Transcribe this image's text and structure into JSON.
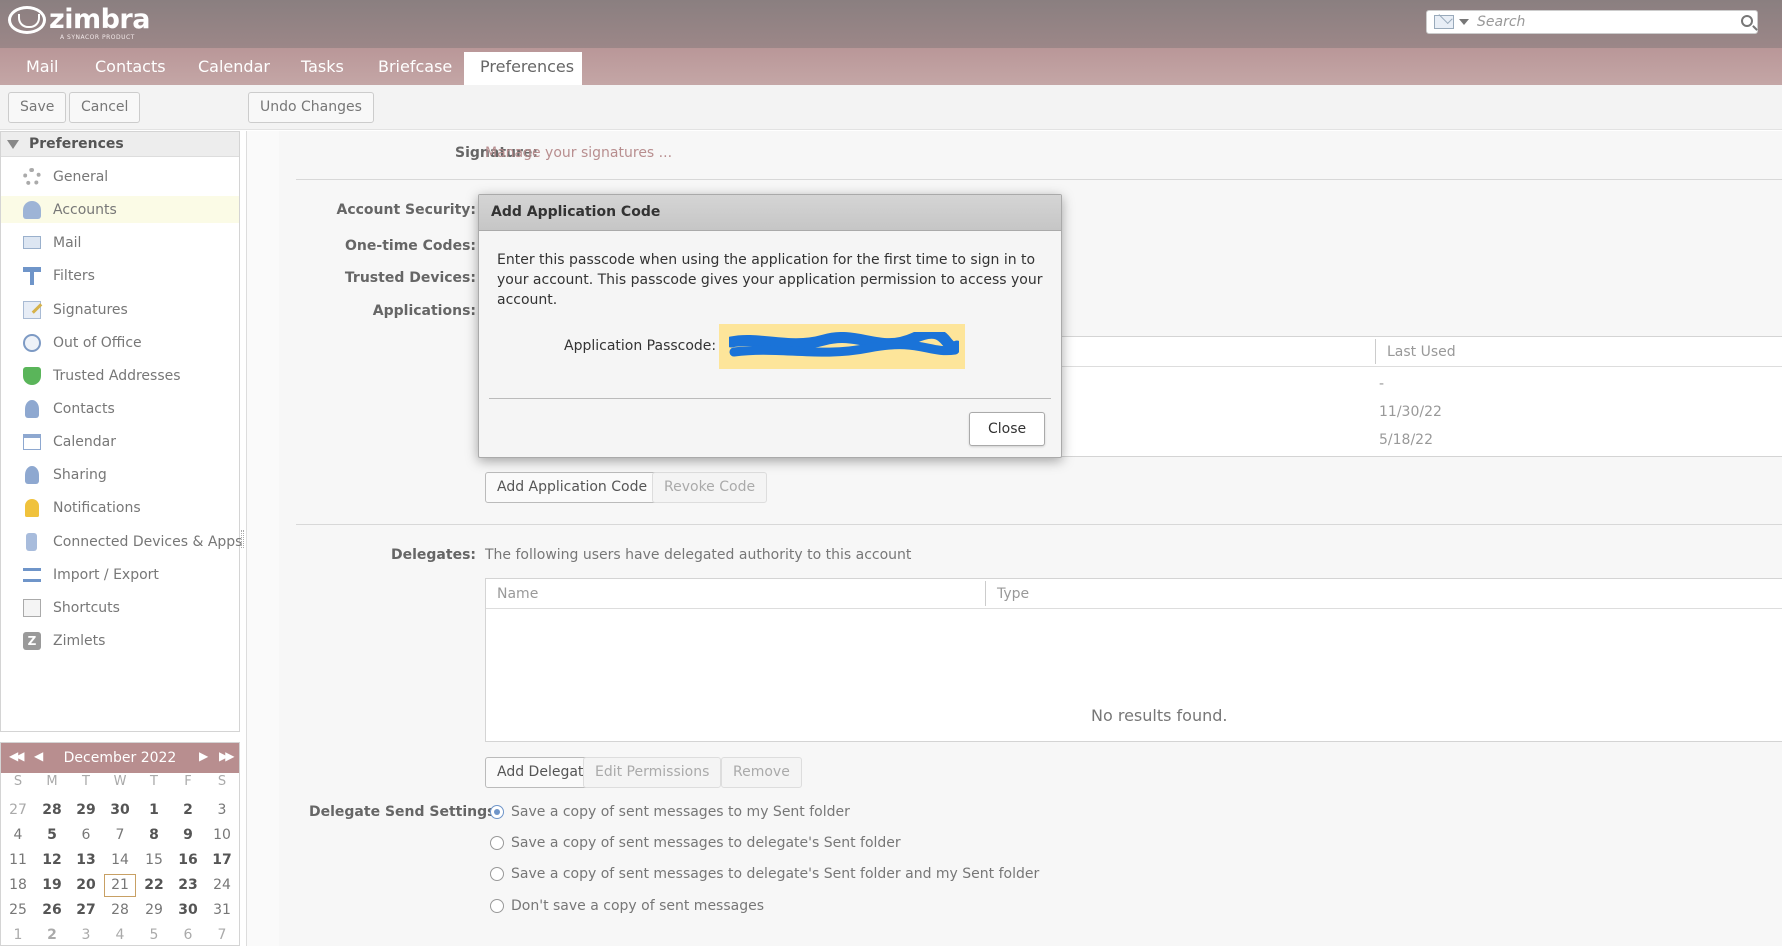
{
  "app": {
    "logo_text": "zimbra",
    "logo_subtitle": "A SYNACOR PRODUCT",
    "search_placeholder": "Search",
    "search_mail_icon": "envelope-icon",
    "search_icon": "magnifier-icon"
  },
  "tabs": [
    {
      "label": "Mail",
      "active": false
    },
    {
      "label": "Contacts",
      "active": false
    },
    {
      "label": "Calendar",
      "active": false
    },
    {
      "label": "Tasks",
      "active": false
    },
    {
      "label": "Briefcase",
      "active": false
    },
    {
      "label": "Preferences",
      "active": true
    }
  ],
  "toolbar": {
    "save_label": "Save",
    "cancel_label": "Cancel",
    "undo_label": "Undo Changes"
  },
  "sidebar": {
    "header": "Preferences",
    "items": [
      {
        "label": "General",
        "icon": "gear-icon",
        "selected": false
      },
      {
        "label": "Accounts",
        "icon": "accounts-icon",
        "selected": true
      },
      {
        "label": "Mail",
        "icon": "mail-icon",
        "selected": false
      },
      {
        "label": "Filters",
        "icon": "filter-icon",
        "selected": false
      },
      {
        "label": "Signatures",
        "icon": "signature-icon",
        "selected": false
      },
      {
        "label": "Out of Office",
        "icon": "out-of-office-icon",
        "selected": false
      },
      {
        "label": "Trusted Addresses",
        "icon": "shield-icon",
        "selected": false
      },
      {
        "label": "Contacts",
        "icon": "contact-icon",
        "selected": false
      },
      {
        "label": "Calendar",
        "icon": "calendar-icon",
        "selected": false
      },
      {
        "label": "Sharing",
        "icon": "sharing-icon",
        "selected": false
      },
      {
        "label": "Notifications",
        "icon": "bell-icon",
        "selected": false
      },
      {
        "label": "Connected Devices & Apps",
        "icon": "device-icon",
        "selected": false
      },
      {
        "label": "Import / Export",
        "icon": "import-export-icon",
        "selected": false
      },
      {
        "label": "Shortcuts",
        "icon": "shortcut-icon",
        "selected": false
      },
      {
        "label": "Zimlets",
        "icon": "zimlet-icon",
        "selected": false
      }
    ]
  },
  "calendar": {
    "month_label": "December 2022",
    "weekdays": [
      "S",
      "M",
      "T",
      "W",
      "T",
      "F",
      "S"
    ],
    "weeks": [
      [
        {
          "d": "27",
          "s": "prev"
        },
        {
          "d": "28",
          "s": "bold"
        },
        {
          "d": "29",
          "s": "bold"
        },
        {
          "d": "30",
          "s": "bold"
        },
        {
          "d": "1",
          "s": "bold"
        },
        {
          "d": "2",
          "s": "bold"
        },
        {
          "d": "3",
          "s": "normal"
        }
      ],
      [
        {
          "d": "4",
          "s": "normal"
        },
        {
          "d": "5",
          "s": "bold"
        },
        {
          "d": "6",
          "s": "normal"
        },
        {
          "d": "7",
          "s": "normal"
        },
        {
          "d": "8",
          "s": "bold"
        },
        {
          "d": "9",
          "s": "bold"
        },
        {
          "d": "10",
          "s": "normal"
        }
      ],
      [
        {
          "d": "11",
          "s": "normal"
        },
        {
          "d": "12",
          "s": "bold"
        },
        {
          "d": "13",
          "s": "bold"
        },
        {
          "d": "14",
          "s": "normal"
        },
        {
          "d": "15",
          "s": "normal"
        },
        {
          "d": "16",
          "s": "bold"
        },
        {
          "d": "17",
          "s": "bold"
        }
      ],
      [
        {
          "d": "18",
          "s": "normal"
        },
        {
          "d": "19",
          "s": "bold"
        },
        {
          "d": "20",
          "s": "bold"
        },
        {
          "d": "21",
          "s": "today"
        },
        {
          "d": "22",
          "s": "bold"
        },
        {
          "d": "23",
          "s": "bold"
        },
        {
          "d": "24",
          "s": "normal"
        }
      ],
      [
        {
          "d": "25",
          "s": "normal"
        },
        {
          "d": "26",
          "s": "bold"
        },
        {
          "d": "27",
          "s": "bold"
        },
        {
          "d": "28",
          "s": "normal"
        },
        {
          "d": "29",
          "s": "normal"
        },
        {
          "d": "30",
          "s": "bold"
        },
        {
          "d": "31",
          "s": "normal"
        }
      ],
      [
        {
          "d": "1",
          "s": "next"
        },
        {
          "d": "2",
          "s": "nextbold"
        },
        {
          "d": "3",
          "s": "next"
        },
        {
          "d": "4",
          "s": "next"
        },
        {
          "d": "5",
          "s": "next"
        },
        {
          "d": "6",
          "s": "next"
        },
        {
          "d": "7",
          "s": "next"
        }
      ]
    ]
  },
  "content": {
    "signature_label": "Signature:",
    "signature_link": "Manage your signatures ...",
    "account_security_label": "Account Security:",
    "onetime_label": "One-time Codes:",
    "trusted_devices_label": "Trusted Devices:",
    "applications_label": "Applications:",
    "apps_grid": {
      "last_used_header": "Last Used",
      "rows": [
        "-",
        "11/30/22",
        "5/18/22"
      ]
    },
    "add_app_code_btn": "Add Application Code",
    "revoke_code_btn": "Revoke Code",
    "delegates_label": "Delegates:",
    "delegates_text": "The following users have delegated authority to this account",
    "delegates_grid": {
      "name_header": "Name",
      "type_header": "Type",
      "empty_text": "No results found."
    },
    "add_delegate_btn": "Add Delegate",
    "edit_permissions_btn": "Edit Permissions",
    "remove_btn": "Remove",
    "delegate_send_label": "Delegate Send Settings:",
    "send_options": [
      {
        "label": "Save a copy of sent messages to my Sent folder",
        "checked": true
      },
      {
        "label": "Save a copy of sent messages to delegate's Sent folder",
        "checked": false
      },
      {
        "label": "Save a copy of sent messages to delegate's Sent folder and my Sent folder",
        "checked": false
      },
      {
        "label": "Don't save a copy of sent messages",
        "checked": false
      }
    ]
  },
  "dialog": {
    "title": "Add Application Code",
    "body": "Enter this passcode when using the application for the first time to sign in to your account. This passcode gives your application permission to access your account.",
    "passcode_label": "Application Passcode:",
    "passcode_redaction_color": "#1a73d8",
    "passcode_bg_color": "#fde59a",
    "close_label": "Close"
  },
  "colors": {
    "header_bg": "#8a7f80",
    "nav_bg": "#bf9e9f",
    "link": "#b88e8f",
    "calendar_header": "#b88e8f",
    "selected_row": "#fbfbe6"
  }
}
